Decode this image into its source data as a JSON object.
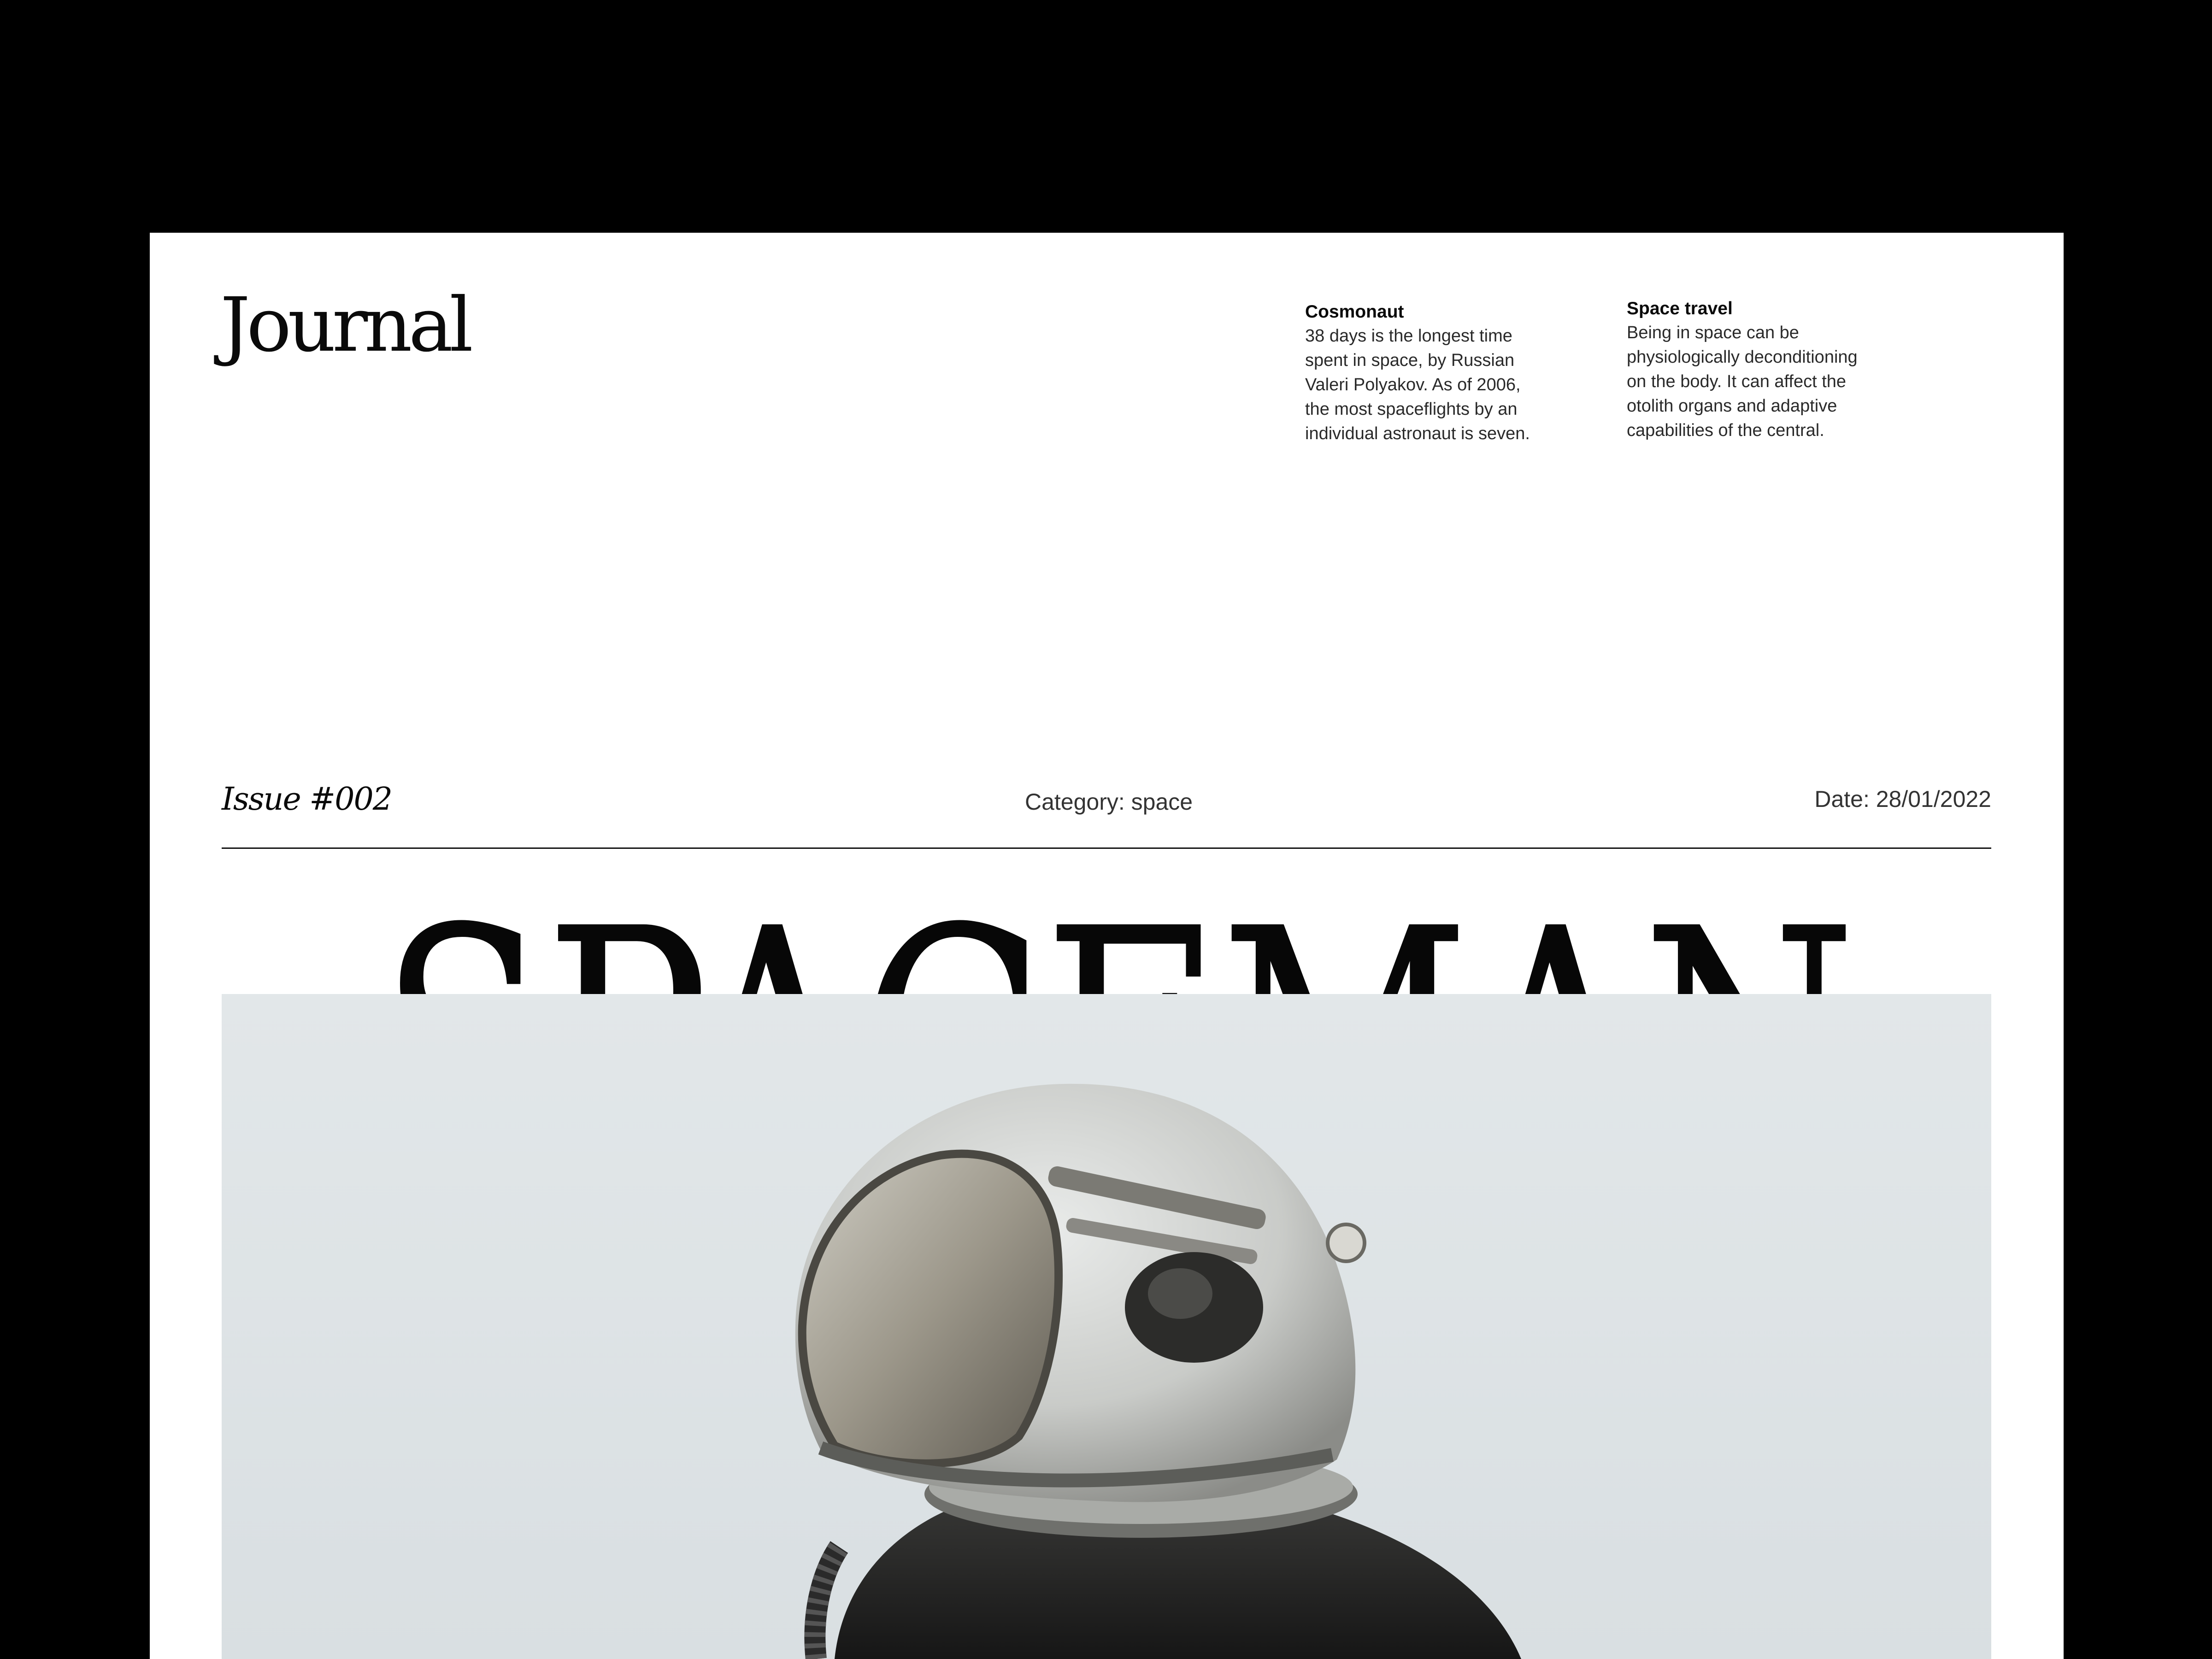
{
  "masthead": "Journal",
  "facts": [
    {
      "title": "Cosmonaut",
      "body": "38 days is the longest time\nspent in space, by Russian\nValeri Polyakov. As of 2006,\nthe most spaceflights by an\nindividual astronaut is seven."
    },
    {
      "title": "Space travel",
      "body": "Being in space can be\nphysiologically deconditioning\non the body. It can affect the\notolith organs and adaptive\ncapabilities of the central."
    }
  ],
  "meta": {
    "issue": "Issue #002",
    "category": "Category: space",
    "date": "Date: 28/01/2022"
  },
  "headline": "SPACEMAN",
  "colors": {
    "frame": "#000000",
    "paper": "#ffffff",
    "ink": "#0a0a0a",
    "sky": "#dfe4e6"
  }
}
